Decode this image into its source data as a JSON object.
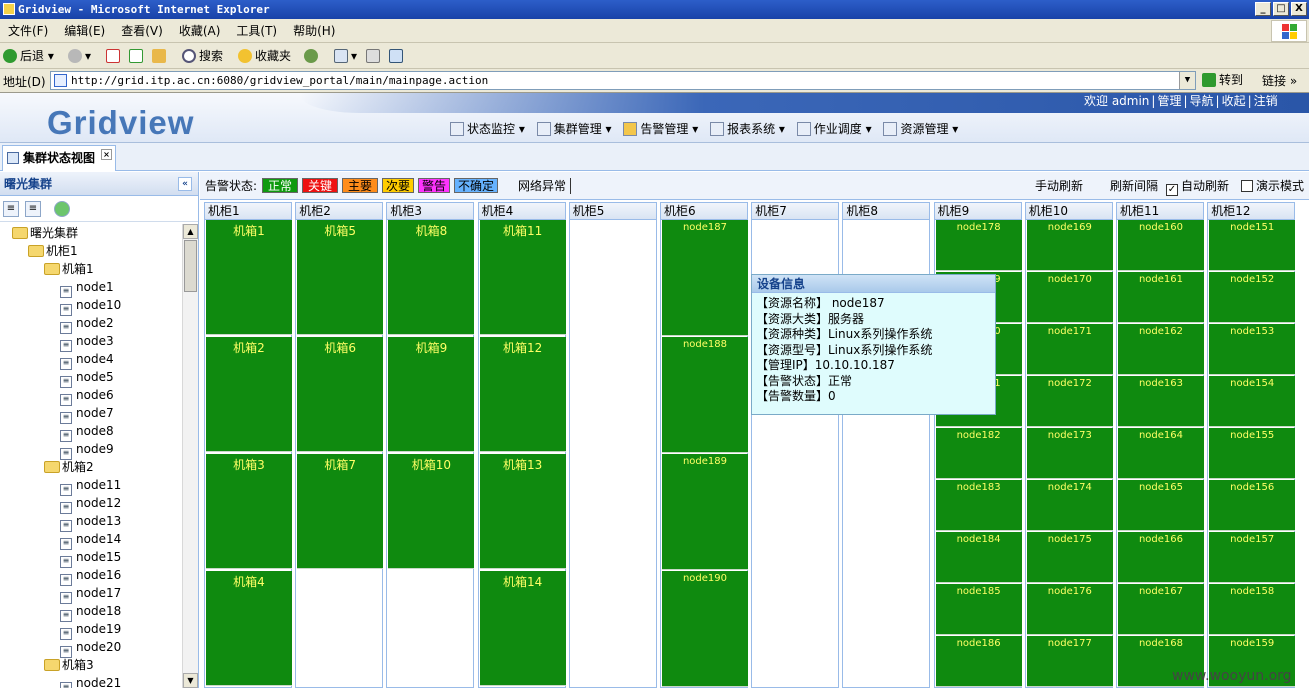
{
  "window": {
    "title": "Gridview - Microsoft Internet Explorer",
    "btn_min": "_",
    "btn_max": "□",
    "btn_close": "X"
  },
  "menu": [
    "文件(F)",
    "编辑(E)",
    "查看(V)",
    "收藏(A)",
    "工具(T)",
    "帮助(H)"
  ],
  "toolbar": {
    "back": "后退",
    "search": "搜索",
    "favorites": "收藏夹"
  },
  "address": {
    "label": "地址(D)",
    "url": "http://grid.itp.ac.cn:6080/gridview_portal/main/mainpage.action",
    "go": "转到",
    "links": "链接 »"
  },
  "app": {
    "logo": "Gridview"
  },
  "user_links": [
    "欢迎 admin",
    "管理",
    "导航",
    "收起",
    "注销"
  ],
  "nav": [
    "状态监控",
    "集群管理",
    "告警管理",
    "报表系统",
    "作业调度",
    "资源管理"
  ],
  "tab": {
    "label": "集群状态视图",
    "close": "×"
  },
  "left": {
    "title": "曙光集群",
    "collapse": "«",
    "tree": [
      {
        "label": "曙光集群",
        "level": 0,
        "type": "folder"
      },
      {
        "label": "机柜1",
        "level": 1,
        "type": "folder"
      },
      {
        "label": "机箱1",
        "level": 2,
        "type": "folder"
      },
      {
        "label": "node1",
        "level": 3,
        "type": "leaf"
      },
      {
        "label": "node10",
        "level": 3,
        "type": "leaf"
      },
      {
        "label": "node2",
        "level": 3,
        "type": "leaf"
      },
      {
        "label": "node3",
        "level": 3,
        "type": "leaf"
      },
      {
        "label": "node4",
        "level": 3,
        "type": "leaf"
      },
      {
        "label": "node5",
        "level": 3,
        "type": "leaf"
      },
      {
        "label": "node6",
        "level": 3,
        "type": "leaf"
      },
      {
        "label": "node7",
        "level": 3,
        "type": "leaf"
      },
      {
        "label": "node8",
        "level": 3,
        "type": "leaf"
      },
      {
        "label": "node9",
        "level": 3,
        "type": "leaf"
      },
      {
        "label": "机箱2",
        "level": 2,
        "type": "folder"
      },
      {
        "label": "node11",
        "level": 3,
        "type": "leaf"
      },
      {
        "label": "node12",
        "level": 3,
        "type": "leaf"
      },
      {
        "label": "node13",
        "level": 3,
        "type": "leaf"
      },
      {
        "label": "node14",
        "level": 3,
        "type": "leaf"
      },
      {
        "label": "node15",
        "level": 3,
        "type": "leaf"
      },
      {
        "label": "node16",
        "level": 3,
        "type": "leaf"
      },
      {
        "label": "node17",
        "level": 3,
        "type": "leaf"
      },
      {
        "label": "node18",
        "level": 3,
        "type": "leaf"
      },
      {
        "label": "node19",
        "level": 3,
        "type": "leaf"
      },
      {
        "label": "node20",
        "level": 3,
        "type": "leaf"
      },
      {
        "label": "机箱3",
        "level": 2,
        "type": "folder"
      },
      {
        "label": "node21",
        "level": 3,
        "type": "leaf"
      }
    ]
  },
  "status": {
    "label": "告警状态:",
    "legend": [
      {
        "label": "正常",
        "color": "#0f9a0f",
        "fg": "#ffffff"
      },
      {
        "label": "关键",
        "color": "#ee1111",
        "fg": "#ffffff"
      },
      {
        "label": "主要",
        "color": "#ff8c1a",
        "fg": "#000000"
      },
      {
        "label": "次要",
        "color": "#ffcc00",
        "fg": "#000000"
      },
      {
        "label": "警告",
        "color": "#ff33ff",
        "fg": "#000000"
      },
      {
        "label": "不确定",
        "color": "#66b2ff",
        "fg": "#000000"
      }
    ],
    "net": "网络异常",
    "manual_refresh": "手动刷新",
    "interval": "刷新间隔",
    "auto_refresh": "自动刷新",
    "demo": "演示模式",
    "check": "✓"
  },
  "cabinets": [
    {
      "name": "机柜1",
      "kind": "chassis",
      "items": [
        "机箱1",
        "机箱2",
        "机箱3",
        "机箱4"
      ]
    },
    {
      "name": "机柜2",
      "kind": "chassis",
      "items": [
        "机箱5",
        "机箱6",
        "机箱7"
      ]
    },
    {
      "name": "机柜3",
      "kind": "chassis",
      "items": [
        "机箱8",
        "机箱9",
        "机箱10"
      ]
    },
    {
      "name": "机柜4",
      "kind": "chassis",
      "items": [
        "机箱11",
        "机箱12",
        "机箱13",
        "机箱14"
      ]
    },
    {
      "name": "机柜5",
      "kind": "empty",
      "items": []
    },
    {
      "name": "机柜6",
      "kind": "tall",
      "items": [
        "node187",
        "node188",
        "node189",
        "node190"
      ]
    },
    {
      "name": "机柜7",
      "kind": "empty",
      "items": []
    },
    {
      "name": "机柜8",
      "kind": "empty",
      "items": []
    },
    {
      "name": "机柜9",
      "kind": "node",
      "items": [
        "node178",
        "node179",
        "node180",
        "node181",
        "node182",
        "node183",
        "node184",
        "node185",
        "node186"
      ]
    },
    {
      "name": "机柜10",
      "kind": "node",
      "items": [
        "node169",
        "node170",
        "node171",
        "node172",
        "node173",
        "node174",
        "node175",
        "node176",
        "node177"
      ]
    },
    {
      "name": "机柜11",
      "kind": "node",
      "items": [
        "node160",
        "node161",
        "node162",
        "node163",
        "node164",
        "node165",
        "node166",
        "node167",
        "node168"
      ]
    },
    {
      "name": "机柜12",
      "kind": "node",
      "items": [
        "node151",
        "node152",
        "node153",
        "node154",
        "node155",
        "node156",
        "node157",
        "node158",
        "node159"
      ]
    }
  ],
  "tooltip": {
    "title": "设备信息",
    "rows": [
      "【资源名称】  node187",
      "【资源大类】服务器",
      "【资源种类】Linux系列操作系统",
      "【资源型号】Linux系列操作系统",
      "【管理IP】10.10.10.187",
      "【告警状态】正常",
      "【告警数量】0"
    ]
  },
  "watermark": "www.wooyun.org"
}
